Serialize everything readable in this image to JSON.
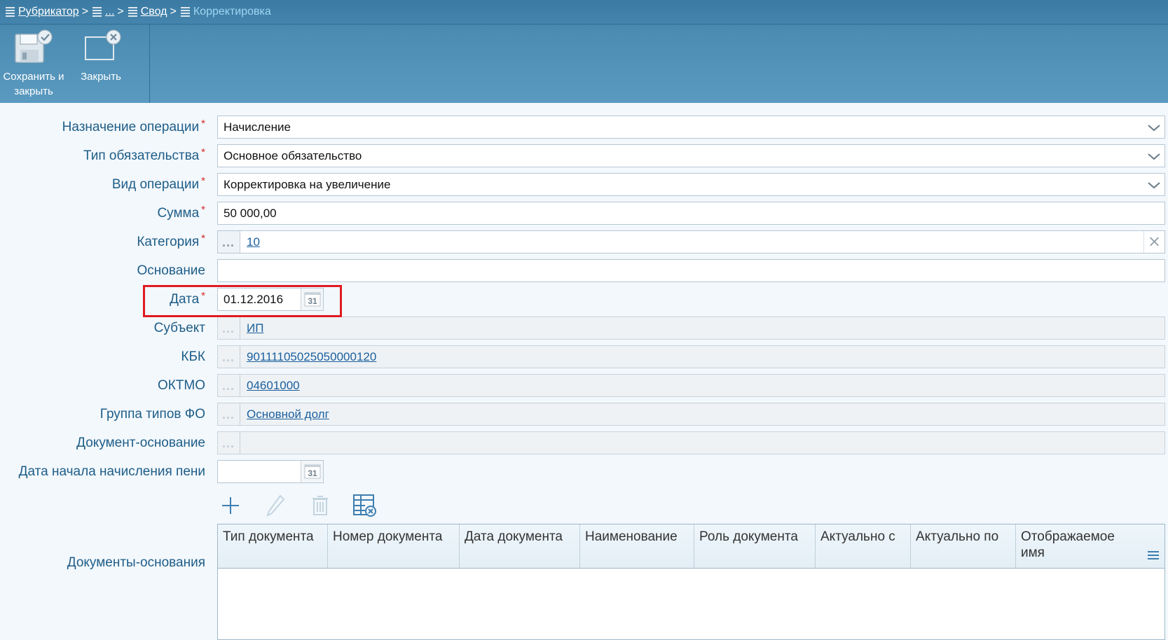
{
  "breadcrumb": {
    "items": [
      "Рубрикатор",
      "...",
      "Свод"
    ],
    "separator": ">",
    "current": "Корректировка"
  },
  "toolbar": {
    "save_label": "Сохранить и закрыть",
    "close_label": "Закрыть"
  },
  "form": {
    "purpose": {
      "label": "Назначение операции",
      "value": "Начисление",
      "required": true
    },
    "liability_type": {
      "label": "Тип обязательства",
      "value": "Основное обязательство",
      "required": true
    },
    "operation_type": {
      "label": "Вид операции",
      "value": "Корректировка на увеличение",
      "required": true
    },
    "amount": {
      "label": "Сумма",
      "value": "50 000,00",
      "required": true
    },
    "category": {
      "label": "Категория",
      "value": "10",
      "required": true
    },
    "basis": {
      "label": "Основание",
      "value": ""
    },
    "date": {
      "label": "Дата",
      "value": "01.12.2016",
      "required": true
    },
    "subject": {
      "label": "Субъект",
      "value": "ИП "
    },
    "kbk": {
      "label": "КБК",
      "value": "90111105025050000120"
    },
    "oktmo": {
      "label": "ОКТМО",
      "value": "04601000"
    },
    "fo_group": {
      "label": "Группа типов ФО",
      "value": "Основной долг"
    },
    "basis_document": {
      "label": "Документ-основание",
      "value": ""
    },
    "penalty_start_date": {
      "label": "Дата начала начисления пени",
      "value": ""
    },
    "basis_documents": {
      "label": "Документы-основания"
    },
    "required_mark": "*",
    "calendar_glyph": "31"
  },
  "grid": {
    "columns": [
      "Тип документа",
      "Номер документа",
      "Дата документа",
      "Наименование",
      "Роль документа",
      "Актуально с",
      "Актуально по",
      "Отображаемое имя"
    ],
    "rows": []
  },
  "colors": {
    "header": "#4a89b0",
    "label": "#1e5d88",
    "required": "#d62b2b",
    "link": "#1c5f9e",
    "highlight": "#e01a22"
  }
}
